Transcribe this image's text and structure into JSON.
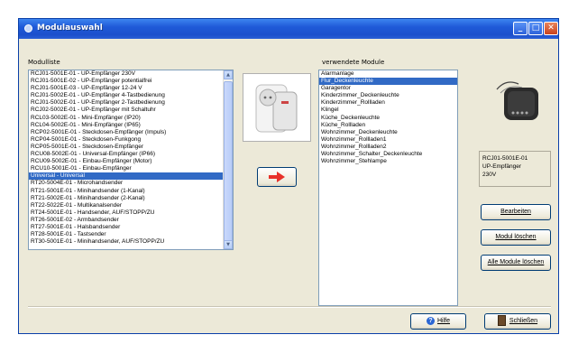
{
  "window": {
    "title": "Modulauswahl"
  },
  "left_list": {
    "label": "Modulliste",
    "selected_index": 14,
    "items": [
      "RCJ01-5001E-01 - UP-Empfänger 230V",
      "RCJ01-5001E-02 - UP-Empfänger potentialfrei",
      "RCJ01-5001E-03 - UP-Empfänger 12-24 V",
      "RCJ01-5002E-01 - UP-Empfänger 4-Tastbedienung",
      "RCJ01-5002E-01 - UP-Empfänger 2-Tastbedienung",
      "RCJ02-5002E-01 - UP-Empfänger mit Schaltuhr",
      "RCL03-5002E-01 - Mini-Empfänger (IP20)",
      "RCL04-5002E-01 - Mini-Empfänger (IP65)",
      "RCP02-5001E-01 - Steckdosen-Empfänger (Impuls)",
      "RCP04-5001E-01 - Steckdosen-Funkgong",
      "RCP05-5001E-01 - Steckdosen-Empfänger",
      "RCU08-5002E-01 - Universal-Empfänger (IP66)",
      "RCU09-5002E-01 - Einbau-Empfänger (Motor)",
      "RCU10-5001E-01 - Einbau-Empfänger",
      "Universal - Universal",
      "RT20-5004E-01 - Microhandsender",
      "RT21-5001E-01 - Minihandsender (1-Kanal)",
      "RT21-5002E-01 - Minihandsender (2-Kanal)",
      "RT22-5022E-01 - Multikanalsender",
      "RT24-5001E-01 - Handsender, AUF/STOPP/ZU",
      "RT26-5001E-02 - Armbandsender",
      "RT27-5001E-01 - Halsbandsender",
      "RT28-5001E-01 - Tastsender",
      "RT30-5001E-01 - Minihandsender, AUF/STOPP/ZU"
    ]
  },
  "right_list": {
    "label": "verwendete Module",
    "selected_index": 1,
    "items": [
      "Alarmanlage",
      "Flur_Deckenleuchte",
      "Garagentor",
      "Kinderzimmer_Deckenleuchte",
      "Kinderzimmer_Rollladen",
      "Klingel",
      "Küche_Deckenleuchte",
      "Küche_Rollladen",
      "Wohnzimmer_Deckenleuchte",
      "Wohnzimmer_Rollladen1",
      "Wohnzimmer_Rollladen2",
      "Wohnzimmer_Schalter_Deckenleuchte",
      "Wohnzimmer_Stehlampe"
    ]
  },
  "info": {
    "line1": "RCJ01-5001E-01",
    "line2": "UP-Empfänger",
    "line3": "230V"
  },
  "buttons": {
    "edit": "Bearbeiten",
    "delete_module": "Modul löschen",
    "delete_all": "Alle Module löschen",
    "help": "Hilfe",
    "close": "Schließen"
  },
  "colors": {
    "title_bar": "#1f5ad8",
    "selection": "#316ac5",
    "arrow": "#e8312a"
  },
  "icons": {
    "add_arrow": "right-arrow-icon",
    "help": "question-icon",
    "close": "exit-door-icon"
  }
}
